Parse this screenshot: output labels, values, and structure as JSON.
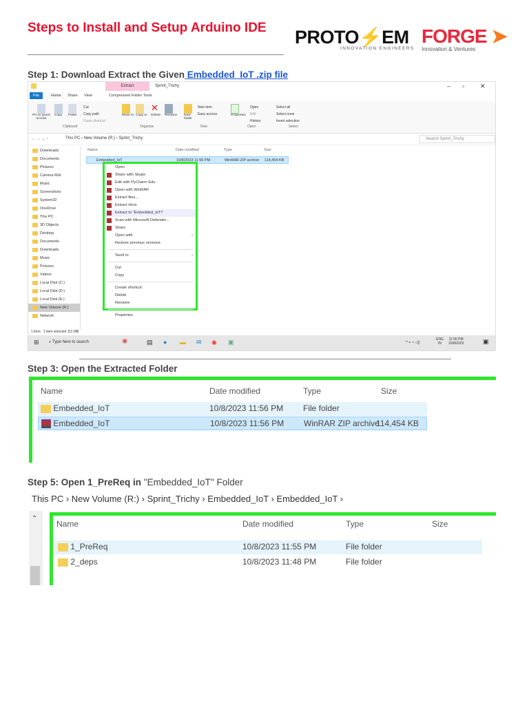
{
  "title": "Steps to Install and Setup Arduino IDE",
  "logos": {
    "protosem": "PROTOSEM",
    "protosem_tm": "™",
    "protosem_tagline": "INNOVATION ENGINEERS",
    "forge": "FORGE",
    "forge_tagline": "Innovation & Ventures"
  },
  "step1": {
    "prefix": "Step 1: Download Extract the Given",
    "link": " Embedded_IoT .zip file"
  },
  "explorer1": {
    "context_tab": "Extract",
    "window_title": "Sprint_Trichy",
    "tabs": [
      "File",
      "Home",
      "Share",
      "View",
      "Compressed Folder Tools"
    ],
    "ribbon": {
      "clipboard": [
        "Pin to Quick access",
        "Copy",
        "Paste",
        "Cut",
        "Copy path",
        "Paste shortcut"
      ],
      "organize": [
        "Move to",
        "Copy to",
        "Delete",
        "Rename"
      ],
      "new": [
        "New folder",
        "New item",
        "Easy access"
      ],
      "open": [
        "Properties",
        "Open",
        "Edit",
        "History"
      ],
      "select": [
        "Select all",
        "Select none",
        "Invert selection"
      ],
      "groups": [
        "Clipboard",
        "Organize",
        "New",
        "Open",
        "Select"
      ]
    },
    "breadcrumb": [
      "This PC",
      "New Volume (R:)",
      "Sprint_Trichy"
    ],
    "search_placeholder": "Search Sprint_Trichy",
    "nav": [
      "Downloads",
      "Documents",
      "Pictures",
      "Camera Roll",
      "Music",
      "Screenshots",
      "System32",
      "OneDrive",
      "This PC",
      "3D Objects",
      "Desktop",
      "Documents",
      "Downloads",
      "Music",
      "Pictures",
      "Videos",
      "Local Disk (C:)",
      "Local Disk (D:)",
      "Local Disk (E:)",
      "New Volume (R:)",
      "Network"
    ],
    "columns": [
      "Name",
      "Date modified",
      "Type",
      "Size"
    ],
    "file": {
      "name": "Embedded_IoT",
      "date": "10/8/2023 11:56 PM",
      "type": "WinRAR ZIP archive",
      "size": "114,454 KB"
    },
    "context_menu": [
      [
        "Open",
        "Share with Skype",
        "Edit with PyCharm Edu",
        "Open with WinRAR",
        "Extract files...",
        "Extract Here",
        "Extract to \"Embedded_IoT\\\"",
        "Scan with Microsoft Defender...",
        "Share",
        "Open with",
        "Restore previous versions"
      ],
      [
        "Send to"
      ],
      [
        "Cut",
        "Copy"
      ],
      [
        "Create shortcut",
        "Delete",
        "Rename"
      ],
      [
        "Properties"
      ]
    ],
    "status": {
      "count": "1 item",
      "selected": "1 item selected  111 MB"
    },
    "taskbar": {
      "search": "Type here to search",
      "lang": "ENG",
      "region": "IN",
      "time": "11:56 PM",
      "date": "10/8/2023"
    }
  },
  "step3": {
    "label": "Step 3: Open the Extracted Folder"
  },
  "explorer2": {
    "columns": [
      "Name",
      "Date modified",
      "Type",
      "Size"
    ],
    "rows": [
      {
        "name": "Embedded_IoT",
        "date": "10/8/2023 11:56 PM",
        "type": "File folder",
        "size": ""
      },
      {
        "name": "Embedded_IoT",
        "date": "10/8/2023 11:56 PM",
        "type": "WinRAR ZIP archive",
        "size": "114,454 KB"
      }
    ]
  },
  "step5": {
    "bold": "Step 5: Open 1_PreReq in",
    "plain": " \"Embedded_IoT\" Folder"
  },
  "explorer3": {
    "breadcrumb": [
      "This PC",
      "New Volume (R:)",
      "Sprint_Trichy",
      "Embedded_IoT",
      "Embedded_IoT"
    ],
    "columns": [
      "Name",
      "Date modified",
      "Type",
      "Size"
    ],
    "rows": [
      {
        "name": "1_PreReq",
        "date": "10/8/2023 11:55 PM",
        "type": "File folder"
      },
      {
        "name": "2_deps",
        "date": "10/8/2023 11:48 PM",
        "type": "File folder"
      }
    ]
  },
  "colors": {
    "accent_red": "#e8112d",
    "highlight_green": "#2ee62e",
    "link": "#1a56d6"
  }
}
